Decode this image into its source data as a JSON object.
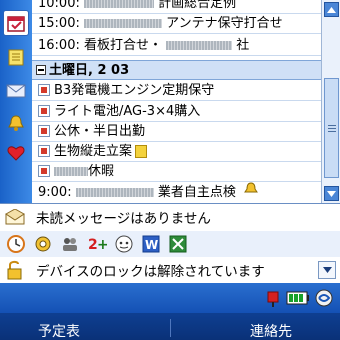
{
  "calendar": {
    "rows": [
      {
        "text": "10:00:",
        "after": "計画総合定例"
      },
      {
        "text": "15:00:",
        "after": "アンテナ保守打合せ"
      },
      {
        "text": "16:00:",
        "after": "看板打合せ・",
        "after2": "社"
      }
    ],
    "date_header": "土曜日, 2 03",
    "events": [
      "B3発電機エンジン定期保守",
      "ライト電池/AG-3×4購入",
      "公休・半日出勤",
      "生物縦走立案",
      "休暇"
    ],
    "last_row": {
      "time": "9:00:",
      "text": "業者自主点検"
    }
  },
  "status": {
    "messages": "未読メッセージはありません",
    "lock": "デバイスのロックは解除されています"
  },
  "softkeys": {
    "left": "予定表",
    "right": "連絡先"
  },
  "colors": {
    "titlebar_blue": "#1a62c8",
    "date_header_bg": "#cfe0f6",
    "softkey_bar": "#0e3f91"
  }
}
